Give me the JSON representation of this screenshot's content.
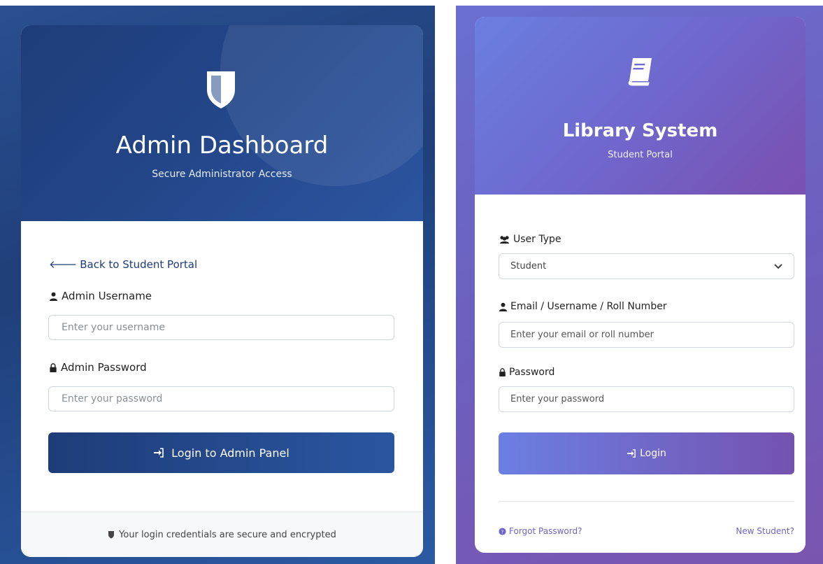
{
  "admin": {
    "title": "Admin Dashboard",
    "subtitle": "Secure Administrator Access",
    "back_link": "Back to Student Portal",
    "username_label": "Admin Username",
    "username_placeholder": "Enter your username",
    "password_label": "Admin Password",
    "password_placeholder": "Enter your password",
    "login_button": "Login to Admin Panel",
    "footer_note": "Your login credentials are secure and encrypted",
    "icons": [
      "shield-icon",
      "arrow-left-icon",
      "user-icon",
      "lock-icon",
      "sign-in-icon"
    ],
    "colors": {
      "primary": "#1e3c78",
      "accent": "#2a56a0"
    }
  },
  "library": {
    "title": "Library System",
    "subtitle": "Student Portal",
    "user_type_label": "User Type",
    "user_type_value": "Student",
    "email_label": "Email / Username / Roll Number",
    "email_placeholder": "Enter your email or roll number",
    "password_label": "Password",
    "password_placeholder": "Enter your password",
    "login_button": "Login",
    "forgot_link": "Forgot Password?",
    "new_student_link": "New Student?",
    "icons": [
      "book-icon",
      "users-icon",
      "user-icon",
      "lock-icon",
      "sign-in-icon",
      "question-circle-icon"
    ],
    "colors": {
      "primary": "#6b7fe2",
      "accent": "#7552b0"
    }
  }
}
